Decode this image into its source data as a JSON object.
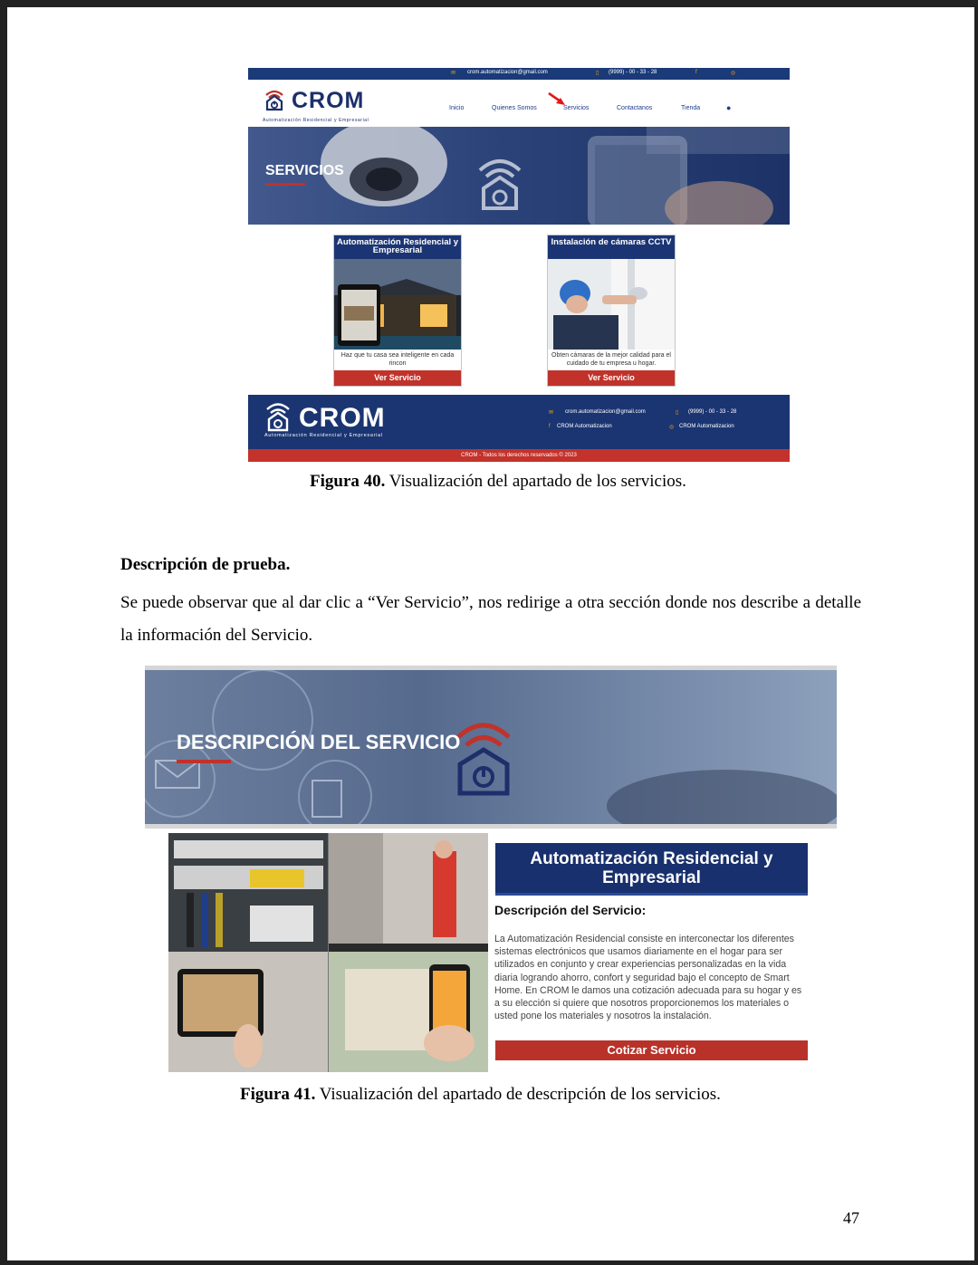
{
  "figure40": {
    "topbar": {
      "email": "crom.automatizacion@gmail.com",
      "phone": "(9999) - 00 - 33 - 28"
    },
    "logo": {
      "name": "CROM",
      "tagline": "Automatización Residencial y Empresarial"
    },
    "nav": [
      "Inicio",
      "Quienes Somos",
      "Servicios",
      "Contactanos",
      "Tienda"
    ],
    "hero_title": "SERVICIOS",
    "cards": [
      {
        "title": "Automatización Residencial y Empresarial",
        "description": "Haz que tu casa sea inteligente en cada rincon",
        "button": "Ver Servicio"
      },
      {
        "title": "Instalación de cámaras CCTV",
        "description": "Obten cámaras de la mejor calidad para el cuidado de tu empresa u hogar.",
        "button": "Ver Servicio"
      }
    ],
    "footer": {
      "logo": "CROM",
      "tagline": "Automatización Residencial y Empresarial",
      "email": "crom.automatizacion@gmail.com",
      "phone": "(9999) - 00 - 33 - 28",
      "facebook": "CROM Automatizacion",
      "instagram": "CROM Automatizacion",
      "copyright": "CROM - Todos los derechos reservados © 2023"
    },
    "caption_label": "Figura 40.",
    "caption_text": " Visualización del apartado de los servicios."
  },
  "section": {
    "heading": "Descripción de prueba.",
    "paragraph": "Se puede observar que al dar clic a “Ver Servicio”, nos redirige a otra sección donde nos describe a detalle la información del Servicio."
  },
  "figure41": {
    "hero_title": "DESCRIPCIÓN DEL SERVICIO",
    "service_title": "Automatización Residencial y Empresarial",
    "desc_label": "Descripción del Servicio:",
    "desc_text": "La Automatización Residencial consiste en interconectar los diferentes sistemas electrónicos que usamos diariamente en el hogar para ser utilizados en conjunto y crear experiencias personalizadas en la vida diaria logrando ahorro, confort y seguridad bajo el concepto de Smart Home. En CROM le damos una cotización adecuada para su hogar y es a su elección si quiere que nosotros proporcionemos los materiales o usted pone los materiales y nosotros la instalación.",
    "button": "Cotizar Servicio",
    "caption_label": "Figura 41.",
    "caption_text": " Visualización del apartado de descripción de los servicios."
  },
  "page_number": "47",
  "colors": {
    "navy": "#1b3572",
    "red": "#c0322a"
  }
}
